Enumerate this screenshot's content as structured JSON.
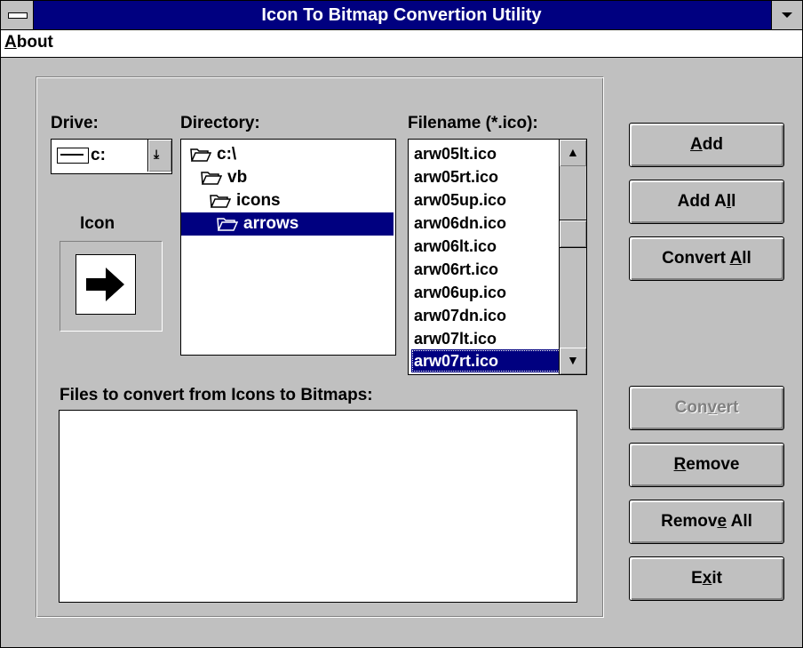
{
  "window": {
    "title": "Icon To Bitmap Convertion Utility"
  },
  "menu": {
    "about": {
      "mnemonic": "A",
      "rest": "bout"
    }
  },
  "labels": {
    "drive": "Drive:",
    "directory": "Directory:",
    "filename": "Filename (*.ico):",
    "icon": "Icon",
    "files_to_convert": "Files to convert from Icons to Bitmaps:"
  },
  "drive": {
    "value": "c:"
  },
  "directories": [
    {
      "name": "c:\\",
      "indent": 0,
      "selected": false
    },
    {
      "name": "vb",
      "indent": 1,
      "selected": false
    },
    {
      "name": "icons",
      "indent": 2,
      "selected": false
    },
    {
      "name": "arrows",
      "indent": 3,
      "selected": true
    }
  ],
  "files": [
    "arw05lt.ico",
    "arw05rt.ico",
    "arw05up.ico",
    "arw06dn.ico",
    "arw06lt.ico",
    "arw06rt.ico",
    "arw06up.ico",
    "arw07dn.ico",
    "arw07lt.ico",
    "arw07rt.ico"
  ],
  "selected_file": "arw07rt.ico",
  "files_to_convert": [],
  "buttons": {
    "add": {
      "pre": "",
      "mn": "A",
      "post": "dd"
    },
    "add_all": {
      "pre": "Add A",
      "mn": "l",
      "post": "l"
    },
    "convert_all": {
      "pre": "Convert ",
      "mn": "A",
      "post": "ll"
    },
    "convert": {
      "pre": "Con",
      "mn": "v",
      "post": "ert"
    },
    "remove": {
      "pre": "",
      "mn": "R",
      "post": "emove"
    },
    "remove_all": {
      "pre": "Remov",
      "mn": "e",
      "post": " All"
    },
    "exit": {
      "pre": "E",
      "mn": "x",
      "post": "it"
    }
  },
  "colors": {
    "titlebar": "#000080",
    "face": "#c0c0c0",
    "selection": "#000080"
  }
}
